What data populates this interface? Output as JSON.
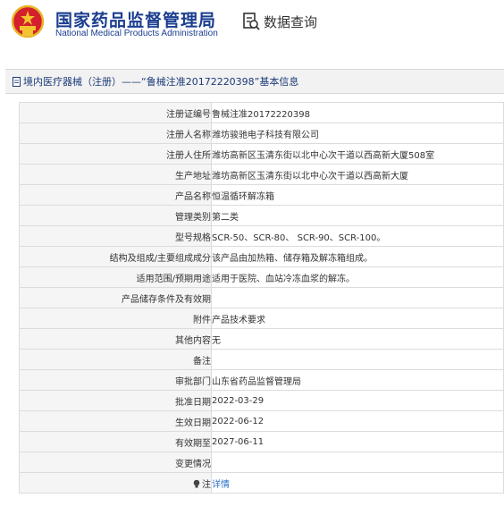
{
  "header": {
    "title_cn": "国家药品监督管理局",
    "title_en": "National Medical Products Administration",
    "search_label": "数据查询"
  },
  "breadcrumb": {
    "text": "境内医疗器械（注册）——“鲁械注准20172220398”基本信息"
  },
  "details": [
    {
      "label": "注册证编号",
      "value": "鲁械注准20172220398"
    },
    {
      "label": "注册人名称",
      "value": "潍坊骏驰电子科技有限公司"
    },
    {
      "label": "注册人住所",
      "value": "潍坊高新区玉清东街以北中心次干道以西高新大厦508室"
    },
    {
      "label": "生产地址",
      "value": "潍坊高新区玉清东街以北中心次干道以西高新大厦"
    },
    {
      "label": "产品名称",
      "value": "恒温循环解冻箱"
    },
    {
      "label": "管理类别",
      "value": "第二类"
    },
    {
      "label": "型号规格",
      "value": "SCR-50、SCR-80、 SCR-90、SCR-100。"
    },
    {
      "label": "结构及组成/主要组成成分",
      "value": "该产品由加热箱、储存箱及解冻箱组成。"
    },
    {
      "label": "适用范围/预期用途",
      "value": "适用于医院、血站冷冻血浆的解冻。"
    },
    {
      "label": "产品储存条件及有效期",
      "value": ""
    },
    {
      "label": "附件",
      "value": "产品技术要求"
    },
    {
      "label": "其他内容",
      "value": "无"
    },
    {
      "label": "备注",
      "value": ""
    },
    {
      "label": "审批部门",
      "value": "山东省药品监督管理局"
    },
    {
      "label": "批准日期",
      "value": "2022-03-29"
    },
    {
      "label": "生效日期",
      "value": "2022-06-12"
    },
    {
      "label": "有效期至",
      "value": "2027-06-11"
    },
    {
      "label": "变更情况",
      "value": ""
    },
    {
      "label": "注",
      "value": "详情"
    }
  ]
}
